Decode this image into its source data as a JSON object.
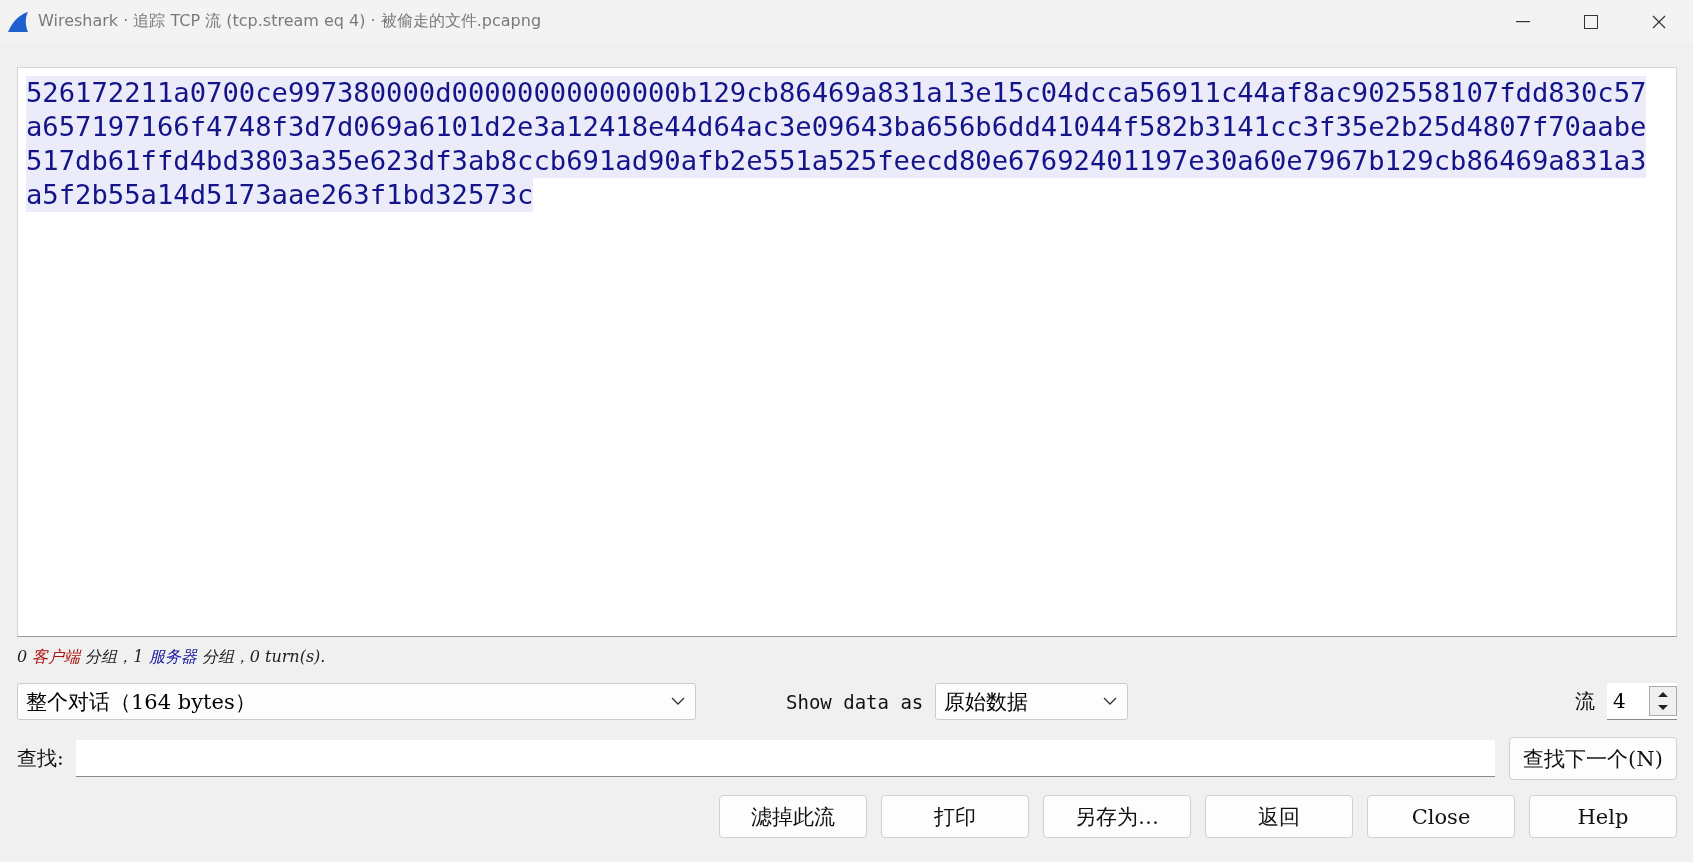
{
  "window": {
    "title": "Wireshark · 追踪 TCP 流 (tcp.stream eq 4) · 被偷走的文件.pcapng"
  },
  "stream_lines": [
    "526172211a0700ce997380000d00000000000000b129cb86469a831a13e15c04dcca56911c44af8ac902558107fdd830c57",
    "a657197166f4748f3d7d069a6101d2e3a12418e44d64ac3e09643ba656b6dd41044f582b3141cc3f35e2b25d4807f70aabe",
    "517db61ffd4bd3803a35e623df3ab8ccb691ad90afb2e551a525feecd80e67692401197e30a60e7967b129cb86469a831a3",
    "a5f2b55a14d5173aae263f1bd32573c"
  ],
  "status": [
    {
      "text": "0 ",
      "kind": "plain"
    },
    {
      "text": "客户端",
      "kind": "client"
    },
    {
      "text": " 分组，1 ",
      "kind": "plain"
    },
    {
      "text": "服务器",
      "kind": "server"
    },
    {
      "text": " 分组，0 turn(s).",
      "kind": "plain"
    }
  ],
  "conversation_select": {
    "value": "整个对话（164 bytes）"
  },
  "show_data_label": "Show data as",
  "format_select": {
    "value": "原始数据"
  },
  "stream_label": "流",
  "stream_spinner": {
    "value": "4"
  },
  "find_label": "查找:",
  "find_next_button": "查找下一个(N)",
  "buttons": [
    "滤掉此流",
    "打印",
    "另存为…",
    "返回",
    "Close",
    "Help"
  ]
}
